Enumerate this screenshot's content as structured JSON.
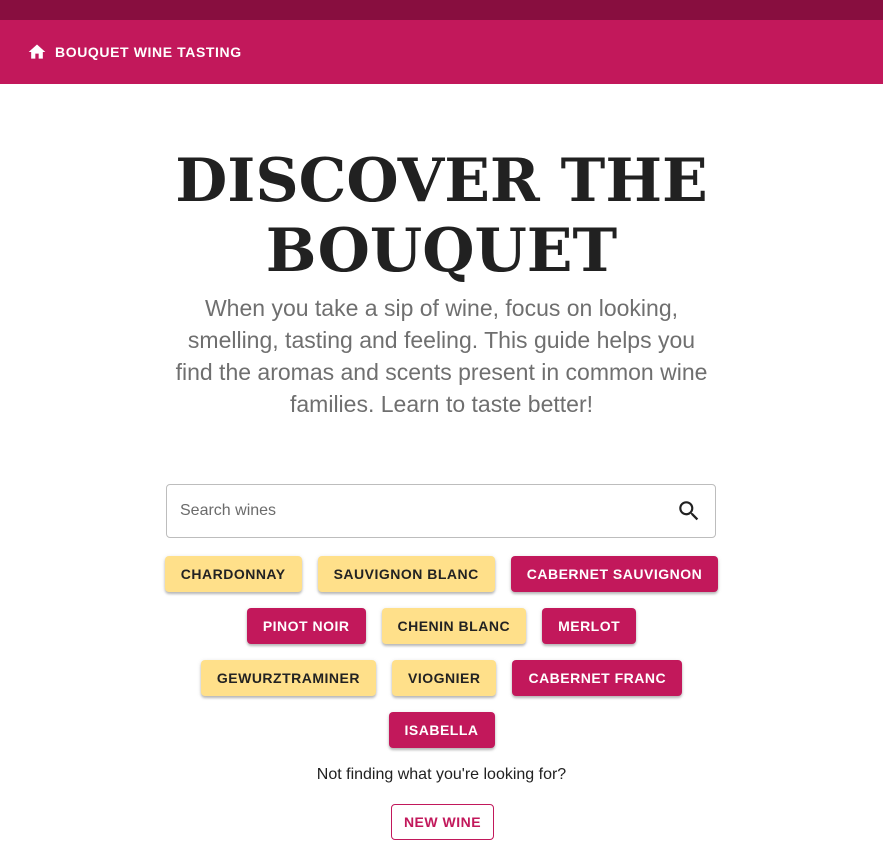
{
  "header": {
    "home_label": "BOUQUET WINE TASTING",
    "home_icon": "home-icon",
    "bar_color": "#c2185b",
    "status_color": "#880e3f"
  },
  "hero": {
    "title_line1": "DISCOVER THE",
    "title_line2": "BOUQUET",
    "subtitle": "When you take a sip of wine, focus on looking, smelling, tasting and feeling. This guide helps you find the aromas and scents present in common wine families. Learn to taste better!"
  },
  "search": {
    "placeholder": "Search wines",
    "value": "",
    "icon": "search-icon"
  },
  "wines": [
    {
      "label": "CHARDONNAY",
      "kind": "white",
      "color": "#ffe08a"
    },
    {
      "label": "SAUVIGNON BLANC",
      "kind": "white",
      "color": "#ffe08a"
    },
    {
      "label": "CABERNET SAUVIGNON",
      "kind": "red",
      "color": "#c2185b"
    },
    {
      "label": "PINOT NOIR",
      "kind": "red",
      "color": "#c2185b"
    },
    {
      "label": "CHENIN BLANC",
      "kind": "white",
      "color": "#ffe08a"
    },
    {
      "label": "MERLOT",
      "kind": "red",
      "color": "#c2185b"
    },
    {
      "label": "GEWURZTRAMINER",
      "kind": "white",
      "color": "#ffe08a"
    },
    {
      "label": "VIOGNIER",
      "kind": "white",
      "color": "#ffe08a"
    },
    {
      "label": "CABERNET FRANC",
      "kind": "red",
      "color": "#c2185b"
    },
    {
      "label": "ISABELLA",
      "kind": "red",
      "color": "#c2185b"
    }
  ],
  "footer": {
    "not_finding": "Not finding what you're looking for?",
    "new_wine_label": "NEW WINE"
  }
}
